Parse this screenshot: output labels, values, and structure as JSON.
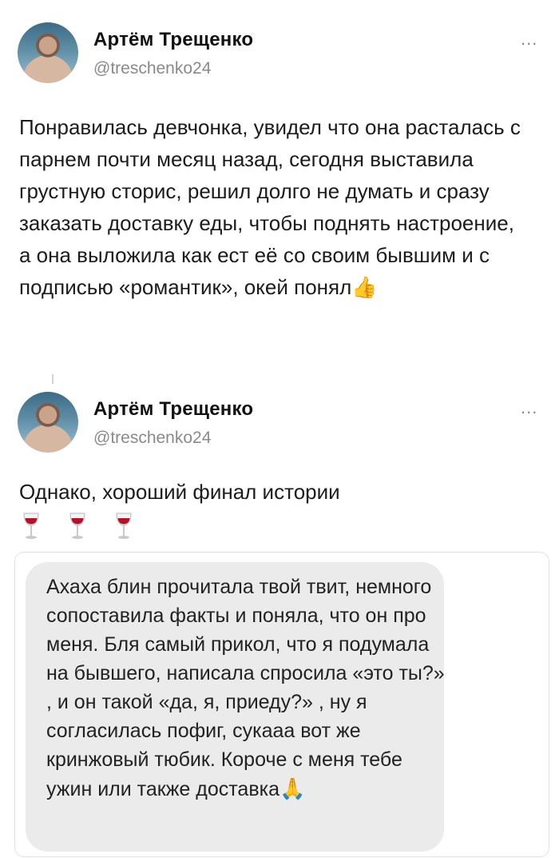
{
  "tweet1": {
    "author_name": "Артём Трещенко",
    "author_handle": "@treschenko24",
    "more": "...",
    "text": "Понравилась девчонка, увидел что она расталась с парнем почти месяц назад, сегодня выставила грустную сторис, решил долго не думать и сразу заказать доставку еды, чтобы поднять настроение, а она выложила как ест её со своим бывшим и с подписью «романтик», окей понял",
    "emoji": "👍"
  },
  "tweet2": {
    "author_name": "Артём Трещенко",
    "author_handle": "@treschenko24",
    "more": "...",
    "text": "Однако, хороший финал истории",
    "emoji_count": 3
  },
  "quoted_message": {
    "text": "Ахаха блин прочитала твой твит, немного сопоставила факты и поняла, что он про меня. Бля самый прикол, что я подумала на бывшего, написала спросила «это ты?» , и он такой «да, я, приеду?» , ну я согласилась пофиг, сукааа вот же кринжовый тюбик. Короче с меня тебе ужин или также доставка",
    "emoji": "🙏"
  },
  "icons": {
    "avatar": "profile-photo",
    "more": "more-options-icon",
    "wine": "wine-glass-icon"
  }
}
